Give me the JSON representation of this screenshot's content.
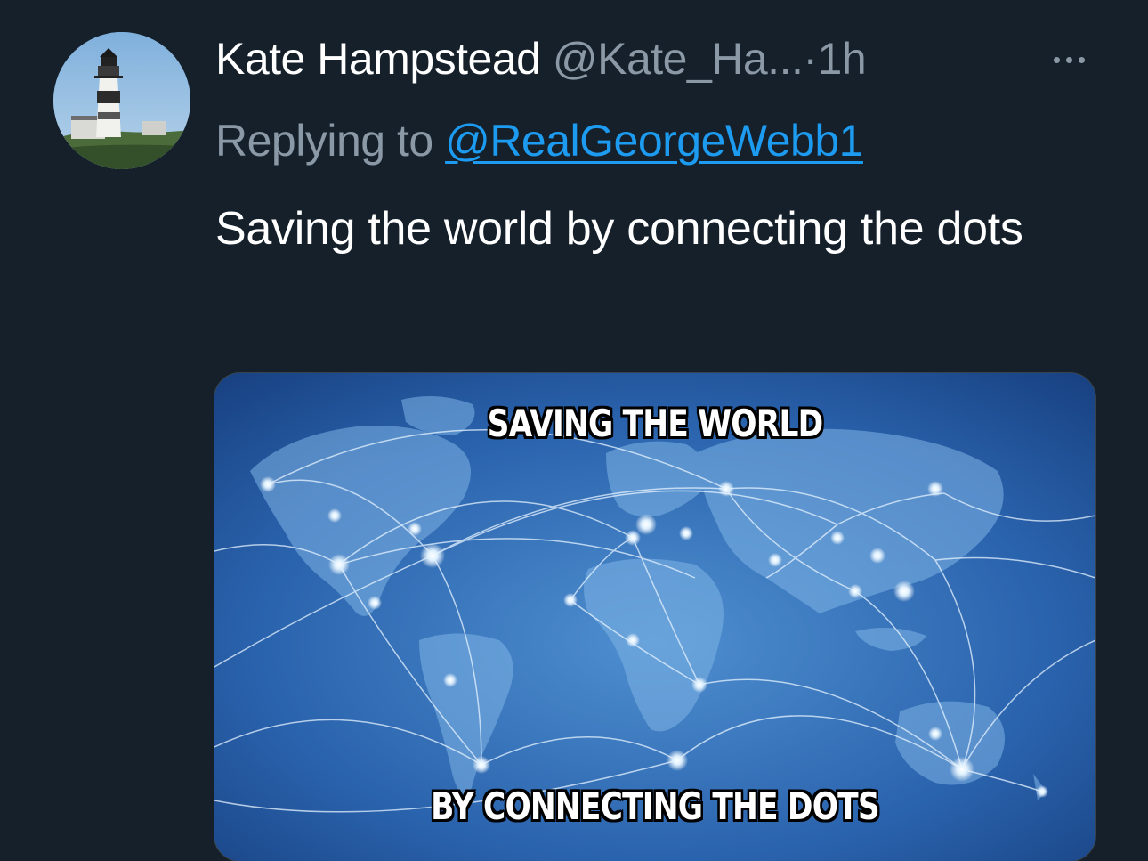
{
  "author": {
    "display_name": "Kate Hampstead",
    "handle": "@Kate_Ha...",
    "separator": "·",
    "time": "1h",
    "avatar_icon": "lighthouse-avatar"
  },
  "reply": {
    "prefix": "Replying to",
    "mention": "@RealGeorgeWebb1"
  },
  "tweet": {
    "text": "Saving the world by connecting the dots"
  },
  "media": {
    "caption_top": "SAVING THE WORLD",
    "caption_bottom": "BY CONNECTING THE DOTS"
  },
  "colors": {
    "background": "#15202b",
    "secondary_text": "#8b98a5",
    "link": "#1d9bf0"
  },
  "icons": {
    "more": "more-horizontal-icon"
  }
}
